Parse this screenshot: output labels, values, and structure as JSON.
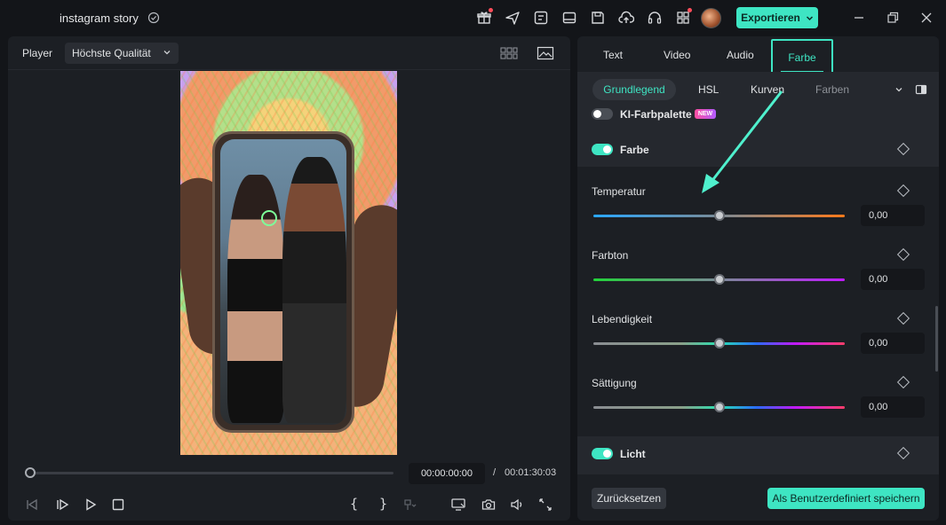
{
  "titlebar": {
    "project_name": "instagram story",
    "export_label": "Exportieren",
    "icons": [
      "gift-icon",
      "send-icon",
      "checklist-icon",
      "layout-icon",
      "save-icon",
      "cloud-upload-icon",
      "headset-icon",
      "grid-icon",
      "avatar",
      "minimize-icon",
      "maximize-icon",
      "close-icon"
    ]
  },
  "player": {
    "label": "Player",
    "quality": "Höchste Qualität",
    "current_time": "00:00:00:00",
    "separator": "/",
    "total_time": "00:01:30:03",
    "progress": 0.0
  },
  "panel": {
    "tabs": [
      "Text",
      "Video",
      "Audio",
      "Farbe"
    ],
    "active_tab": "Farbe",
    "subtabs": [
      "Grundlegend",
      "HSL",
      "Kurven",
      "Farben"
    ],
    "active_subtab": "Grundlegend",
    "ai_palette": {
      "label": "KI-Farbpalette",
      "badge": "NEW",
      "enabled": false
    },
    "color_section": {
      "label": "Farbe",
      "enabled": true
    },
    "params": [
      {
        "label": "Temperatur",
        "value": "0,00",
        "position": 0.5
      },
      {
        "label": "Farbton",
        "value": "0,00",
        "position": 0.5
      },
      {
        "label": "Lebendigkeit",
        "value": "0,00",
        "position": 0.5
      },
      {
        "label": "Sättigung",
        "value": "0,00",
        "position": 0.5
      }
    ],
    "light_section": {
      "label": "Licht",
      "enabled": true
    },
    "reset_label": "Zurücksetzen",
    "save_label": "Als Benutzerdefiniert speichern"
  },
  "colors": {
    "accent": "#3ee5c3",
    "background": "#131519",
    "panel": "#1c1f24"
  }
}
